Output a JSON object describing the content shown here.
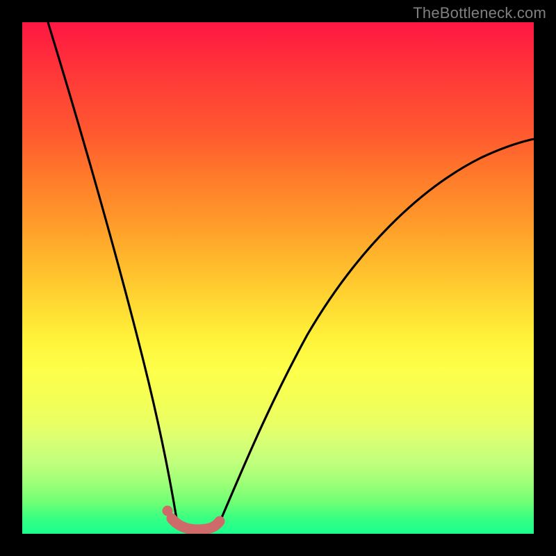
{
  "watermark": "TheBottleneck.com",
  "chart_data": {
    "type": "line",
    "title": "",
    "xlabel": "",
    "ylabel": "",
    "xlim": [
      0,
      100
    ],
    "ylim": [
      0,
      100
    ],
    "series": [
      {
        "name": "left-curve",
        "x": [
          5,
          8,
          11,
          14,
          17,
          20,
          23,
          25,
          27,
          28.5,
          30
        ],
        "y": [
          100,
          85,
          70,
          56,
          43,
          31,
          20,
          12,
          6,
          2.5,
          0.5
        ]
      },
      {
        "name": "right-curve",
        "x": [
          37,
          39,
          42,
          46,
          51,
          57,
          64,
          72,
          81,
          90,
          100
        ],
        "y": [
          0.5,
          3,
          8,
          16,
          26,
          37,
          48,
          58,
          66,
          72,
          77
        ]
      },
      {
        "name": "valley-floor",
        "x": [
          29,
          31,
          33,
          35,
          37,
          38.5
        ],
        "y": [
          1.2,
          0.6,
          0.4,
          0.4,
          0.6,
          1.2
        ]
      }
    ],
    "markers": [
      {
        "name": "left-dot",
        "x": 28.5,
        "y": 3.5
      }
    ],
    "colors": {
      "curve": "#000000",
      "accent": "#d46a6a",
      "background_top": "#ff1744",
      "background_bottom": "#19ff8e",
      "frame": "#000000",
      "watermark": "#808080"
    }
  }
}
